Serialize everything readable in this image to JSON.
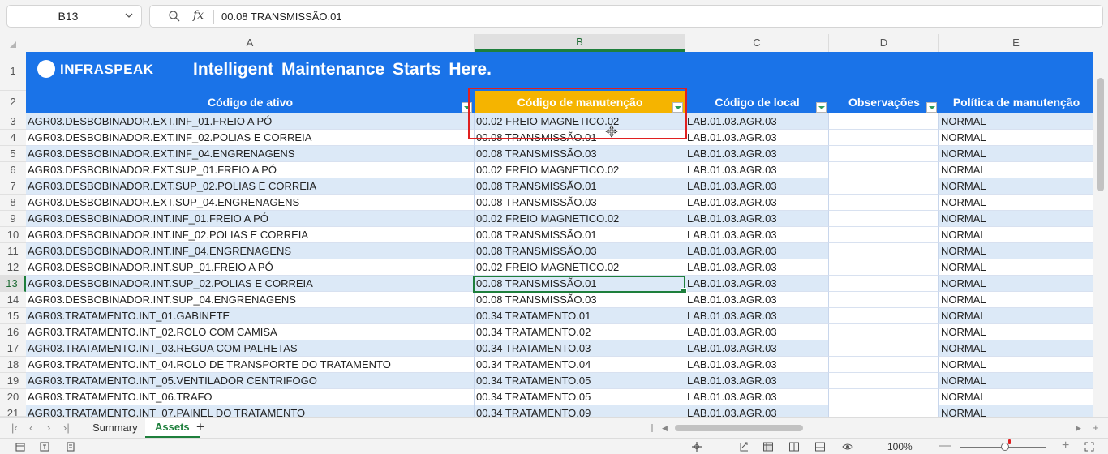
{
  "formula_bar": {
    "name_box": "B13",
    "fx_label": "fx",
    "value": "00.08 TRANSMISSÃO.01"
  },
  "columns": [
    "A",
    "B",
    "C",
    "D",
    "E"
  ],
  "banner": {
    "logo_text": "INFRASPEAK",
    "tagline": "Intelligent  Maintenance  Starts Here."
  },
  "headers": {
    "asset_code": "Código de ativo",
    "maintenance_code": "Código de manutenção",
    "location_code": "Código de local",
    "observations": "Observações",
    "maintenance_policy": "Política de manutenção"
  },
  "row_numbers": [
    "1",
    "2",
    "3",
    "4",
    "5",
    "6",
    "7",
    "8",
    "9",
    "10",
    "11",
    "12",
    "13",
    "14",
    "15",
    "16",
    "17",
    "18",
    "19",
    "20",
    "21"
  ],
  "rows": [
    {
      "asset": "AGR03.DESBOBINADOR.EXT.INF_01.FREIO A PÓ",
      "maint": "00.02 FREIO MAGNETICO.02",
      "loc": "LAB.01.03.AGR.03",
      "obs": "",
      "policy": "NORMAL"
    },
    {
      "asset": "AGR03.DESBOBINADOR.EXT.INF_02.POLIAS E CORREIA",
      "maint": "00.08 TRANSMISSÃO.01",
      "loc": "LAB.01.03.AGR.03",
      "obs": "",
      "policy": "NORMAL"
    },
    {
      "asset": "AGR03.DESBOBINADOR.EXT.INF_04.ENGRENAGENS",
      "maint": "00.08 TRANSMISSÃO.03",
      "loc": "LAB.01.03.AGR.03",
      "obs": "",
      "policy": "NORMAL"
    },
    {
      "asset": "AGR03.DESBOBINADOR.EXT.SUP_01.FREIO A PÓ",
      "maint": "00.02 FREIO MAGNETICO.02",
      "loc": "LAB.01.03.AGR.03",
      "obs": "",
      "policy": "NORMAL"
    },
    {
      "asset": "AGR03.DESBOBINADOR.EXT.SUP_02.POLIAS E CORREIA",
      "maint": "00.08 TRANSMISSÃO.01",
      "loc": "LAB.01.03.AGR.03",
      "obs": "",
      "policy": "NORMAL"
    },
    {
      "asset": "AGR03.DESBOBINADOR.EXT.SUP_04.ENGRENAGENS",
      "maint": "00.08 TRANSMISSÃO.03",
      "loc": "LAB.01.03.AGR.03",
      "obs": "",
      "policy": "NORMAL"
    },
    {
      "asset": "AGR03.DESBOBINADOR.INT.INF_01.FREIO A PÓ",
      "maint": "00.02 FREIO MAGNETICO.02",
      "loc": "LAB.01.03.AGR.03",
      "obs": "",
      "policy": "NORMAL"
    },
    {
      "asset": "AGR03.DESBOBINADOR.INT.INF_02.POLIAS E CORREIA",
      "maint": "00.08 TRANSMISSÃO.01",
      "loc": "LAB.01.03.AGR.03",
      "obs": "",
      "policy": "NORMAL"
    },
    {
      "asset": "AGR03.DESBOBINADOR.INT.INF_04.ENGRENAGENS",
      "maint": "00.08 TRANSMISSÃO.03",
      "loc": "LAB.01.03.AGR.03",
      "obs": "",
      "policy": "NORMAL"
    },
    {
      "asset": "AGR03.DESBOBINADOR.INT.SUP_01.FREIO A PÓ",
      "maint": "00.02 FREIO MAGNETICO.02",
      "loc": "LAB.01.03.AGR.03",
      "obs": "",
      "policy": "NORMAL"
    },
    {
      "asset": "AGR03.DESBOBINADOR.INT.SUP_02.POLIAS E CORREIA",
      "maint": "00.08 TRANSMISSÃO.01",
      "loc": "LAB.01.03.AGR.03",
      "obs": "",
      "policy": "NORMAL"
    },
    {
      "asset": "AGR03.DESBOBINADOR.INT.SUP_04.ENGRENAGENS",
      "maint": "00.08 TRANSMISSÃO.03",
      "loc": "LAB.01.03.AGR.03",
      "obs": "",
      "policy": "NORMAL"
    },
    {
      "asset": "AGR03.TRATAMENTO.INT_01.GABINETE",
      "maint": "00.34 TRATAMENTO.01",
      "loc": "LAB.01.03.AGR.03",
      "obs": "",
      "policy": "NORMAL"
    },
    {
      "asset": "AGR03.TRATAMENTO.INT_02.ROLO COM CAMISA",
      "maint": "00.34 TRATAMENTO.02",
      "loc": "LAB.01.03.AGR.03",
      "obs": "",
      "policy": "NORMAL"
    },
    {
      "asset": "AGR03.TRATAMENTO.INT_03.REGUA COM PALHETAS",
      "maint": "00.34 TRATAMENTO.03",
      "loc": "LAB.01.03.AGR.03",
      "obs": "",
      "policy": "NORMAL"
    },
    {
      "asset": "AGR03.TRATAMENTO.INT_04.ROLO DE TRANSPORTE DO TRATAMENTO",
      "maint": "00.34 TRATAMENTO.04",
      "loc": "LAB.01.03.AGR.03",
      "obs": "",
      "policy": "NORMAL"
    },
    {
      "asset": "AGR03.TRATAMENTO.INT_05.VENTILADOR CENTRIFOGO",
      "maint": "00.34 TRATAMENTO.05",
      "loc": "LAB.01.03.AGR.03",
      "obs": "",
      "policy": "NORMAL"
    },
    {
      "asset": "AGR03.TRATAMENTO.INT_06.TRAFO",
      "maint": "00.34 TRATAMENTO.05",
      "loc": "LAB.01.03.AGR.03",
      "obs": "",
      "policy": "NORMAL"
    },
    {
      "asset": "AGR03.TRATAMENTO.INT_07.PAINEL DO TRATAMENTO",
      "maint": "00.34 TRATAMENTO.09",
      "loc": "LAB.01.03.AGR.03",
      "obs": "",
      "policy": "NORMAL"
    }
  ],
  "tabs": [
    "Summary",
    "Assets"
  ],
  "active_tab": "Assets",
  "status": {
    "zoom": "100%"
  },
  "colors": {
    "banner_blue": "#1a73e8",
    "header_amber": "#f5b400",
    "band_blue": "#dce9f7",
    "excel_green": "#1e7f3c",
    "highlight_red": "#e02020"
  }
}
